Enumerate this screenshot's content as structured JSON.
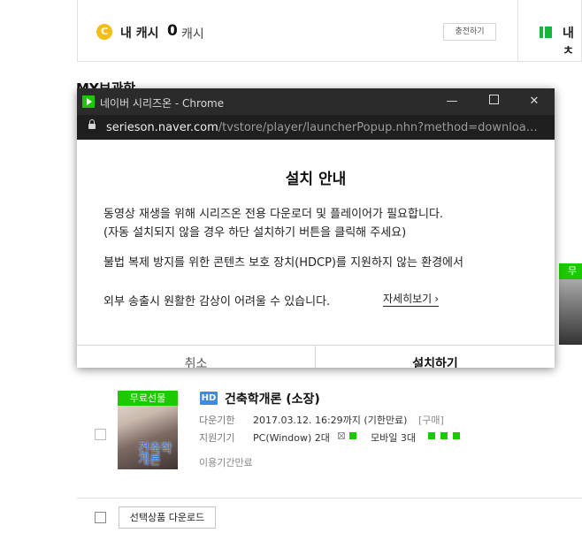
{
  "background_page": {
    "cash": {
      "coin_symbol": "C",
      "label": "내 캐시",
      "value": "0",
      "unit": "캐시",
      "charge_button": "충전하기"
    },
    "ticket": {
      "label": "내 ㅊ"
    },
    "section_title": "MY보관함",
    "promo_badge": "무료",
    "item": {
      "gift_badge": "무료선물",
      "poster_text": "건축학\n개론",
      "hd_badge": "HD",
      "title": "건축학개론 (소장)",
      "download_deadline_label": "다운기한",
      "download_deadline_value": "2017.03.12. 16:29까지 (기한만료)",
      "purchase_tag": "[구매]",
      "devices_label": "지원기기",
      "pc_label": "PC(Window) 2대",
      "mobile_label": "모바일 3대",
      "status": "이용기간만료"
    },
    "download_selected_button": "선택상품 다운로드"
  },
  "popup": {
    "window_title": "네이버 시리즈온 - Chrome",
    "url_domain": "serieson.naver.com",
    "url_path": "/tvstore/player/launcherPopup.nhn?method=download...",
    "dialog_title": "설치 안내",
    "line1": "동영상 재생을 위해 시리즈온 전용 다운로더 및 플레이어가 필요합니다.",
    "line2": "(자동 설치되지 않을 경우 하단 설치하기 버튼을 클릭해 주세요)",
    "line3": "불법 복제 방지를 위한 콘텐츠 보호 장치(HDCP)를 지원하지 않는 환경에서",
    "line4": "외부 송출시 원활한 감상이 어려울 수 있습니다.",
    "details_link": "자세히보기",
    "cancel_button": "취소",
    "install_button": "설치하기"
  },
  "colors": {
    "naver_green": "#1ec800",
    "titlebar": "#2b2b2b",
    "hd_blue": "#3f8ae3",
    "coin_yellow": "#f5bd18"
  }
}
